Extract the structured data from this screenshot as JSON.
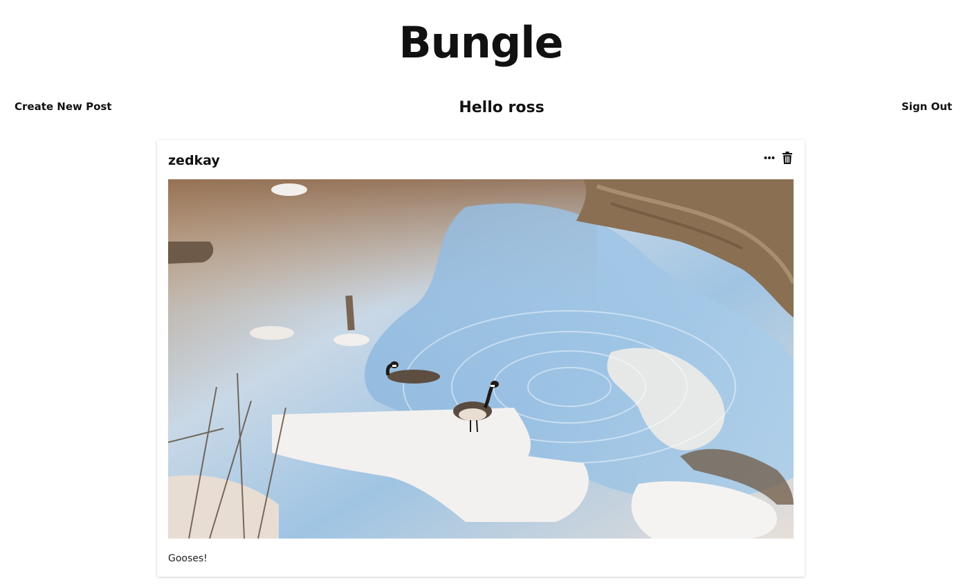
{
  "app": {
    "title": "Bungle"
  },
  "nav": {
    "create_label": "Create New Post",
    "greeting": "Hello ross",
    "signout_label": "Sign Out"
  },
  "post": {
    "author": "zedkay",
    "caption": "Gooses!",
    "actions": {
      "more_icon": "more-horizontal-icon",
      "delete_icon": "trash-icon"
    },
    "image": {
      "subject": "geese-on-icy-creek"
    }
  }
}
